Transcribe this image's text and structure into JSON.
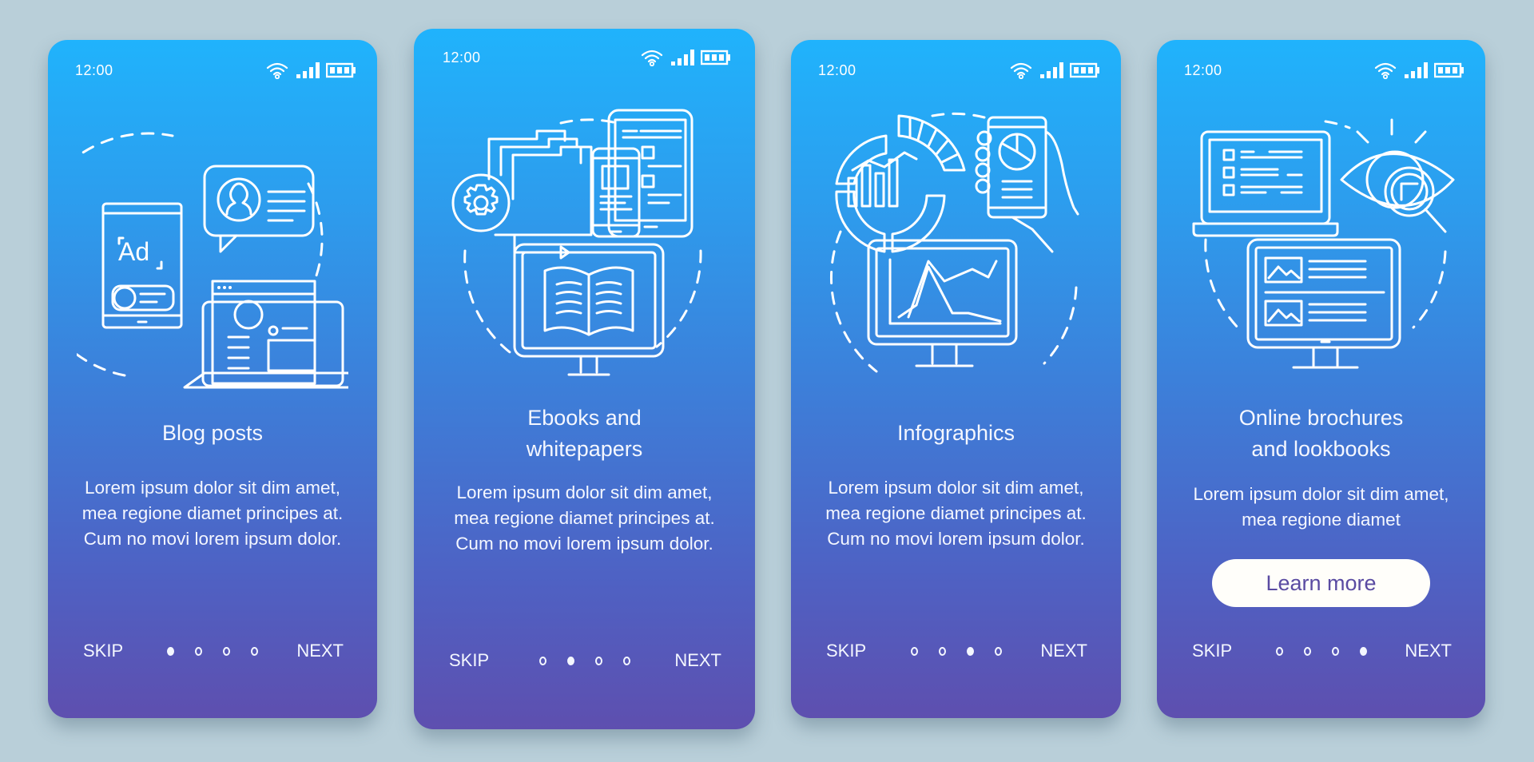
{
  "status_bar": {
    "time": "12:00",
    "icons": [
      "wifi-icon",
      "signal-icon",
      "battery-icon"
    ]
  },
  "colors": {
    "background": "#b9cfd9",
    "gradient_top": "#20b3fc",
    "gradient_bottom": "#5e4faf",
    "text": "#f4f7ff",
    "button_text": "#5a4ba2"
  },
  "screens": [
    {
      "illustration": "blog-posts-illustration",
      "title_line1": "Blog posts",
      "title_line2": "",
      "body": "Lorem ipsum dolor sit dim amet, mea regione diamet principes at. Cum no movi lorem ipsum dolor.",
      "skip": "SKIP",
      "next": "NEXT",
      "page_index": 1,
      "page_count": 4
    },
    {
      "illustration": "ebooks-whitepapers-illustration",
      "title_line1": "Ebooks and",
      "title_line2": "whitepapers",
      "body": "Lorem ipsum dolor sit dim amet, mea regione diamet principes at. Cum no movi lorem ipsum dolor.",
      "skip": "SKIP",
      "next": "NEXT",
      "page_index": 2,
      "page_count": 4
    },
    {
      "illustration": "infographics-illustration",
      "title_line1": "Infographics",
      "title_line2": "",
      "body": "Lorem ipsum dolor sit dim amet, mea regione diamet principes at. Cum no movi lorem ipsum dolor.",
      "skip": "SKIP",
      "next": "NEXT",
      "page_index": 3,
      "page_count": 4
    },
    {
      "illustration": "brochures-lookbooks-illustration",
      "title_line1": "Online brochures",
      "title_line2": "and lookbooks",
      "body": "Lorem ipsum dolor sit dim amet, mea regione diamet",
      "button": "Learn more",
      "skip": "SKIP",
      "next": "NEXT",
      "page_index": 4,
      "page_count": 4
    }
  ]
}
